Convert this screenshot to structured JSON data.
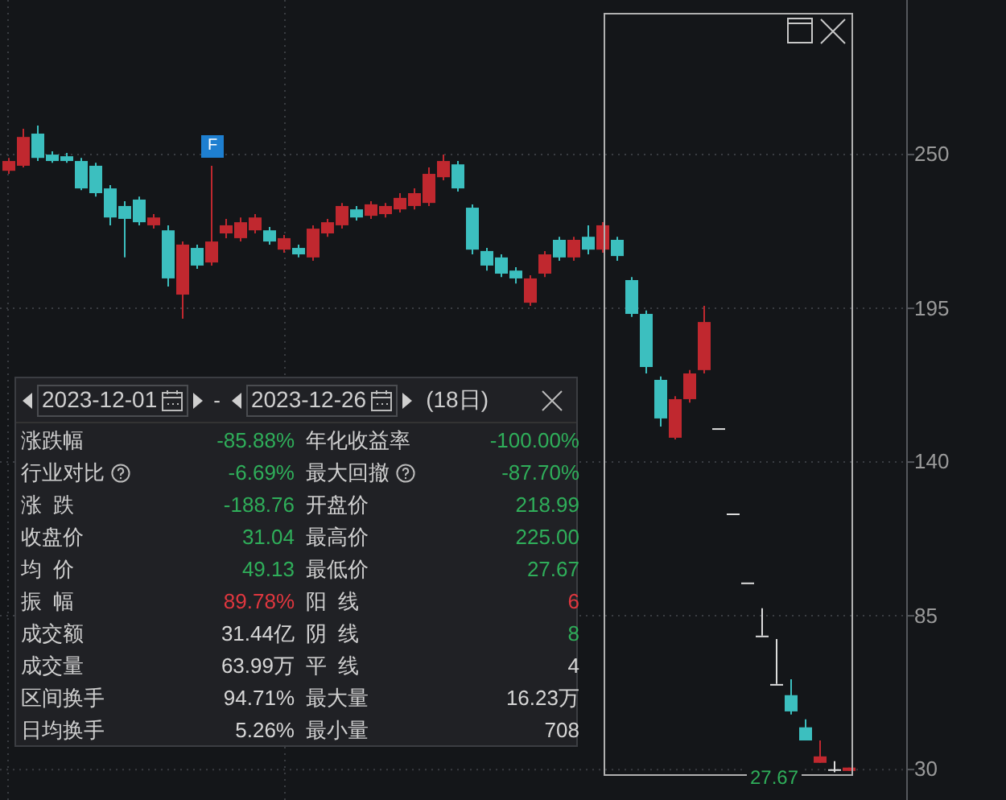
{
  "chart_data": {
    "type": "candlestick",
    "grid": true,
    "ylim": [
      19.1,
      305.3
    ],
    "yticks": [
      250,
      195,
      140,
      85,
      30
    ],
    "categories": [
      null,
      null,
      null,
      null,
      null,
      null,
      null,
      null,
      null,
      null,
      null,
      null,
      null,
      null,
      null,
      null,
      null,
      null,
      null,
      null,
      null,
      null,
      null,
      null,
      null,
      null,
      null,
      null,
      null,
      null,
      null,
      null,
      null,
      null,
      null,
      null,
      null,
      null,
      null,
      null,
      null,
      null,
      null,
      null,
      null,
      null,
      null,
      null,
      null,
      null,
      null,
      null,
      null,
      null,
      null,
      null,
      null,
      null,
      null
    ],
    "ohlc": [
      [
        244.2,
        248.8,
        243.1,
        247.7
      ],
      [
        246,
        259.2,
        245.4,
        256.3
      ],
      [
        257.5,
        260.4,
        247.7,
        248.8
      ],
      [
        250,
        251.2,
        247.1,
        247.7
      ],
      [
        249.4,
        250.6,
        247.1,
        247.7
      ],
      [
        247.7,
        248.8,
        237.3,
        237.9
      ],
      [
        246,
        247.1,
        235,
        236.2
      ],
      [
        237.9,
        239.1,
        224.7,
        227.5
      ],
      [
        231.6,
        233.3,
        213.2,
        227
      ],
      [
        233.9,
        235,
        224.7,
        225.8
      ],
      [
        224.7,
        228.7,
        223.5,
        227.5
      ],
      [
        222.9,
        224.7,
        202.8,
        205.7
      ],
      [
        199.9,
        218.9,
        191.3,
        217.8
      ],
      [
        216.6,
        217.8,
        209.1,
        210.3
      ],
      [
        211.4,
        246,
        210.3,
        218.9
      ],
      [
        221.8,
        227,
        220.1,
        224.7
      ],
      [
        220.1,
        227.5,
        218.9,
        225.8
      ],
      [
        222.9,
        228.7,
        221.8,
        227.5
      ],
      [
        222.9,
        224.1,
        217.8,
        218.9
      ],
      [
        216,
        221.2,
        214.9,
        220.1
      ],
      [
        216.6,
        217.8,
        213.2,
        214.3
      ],
      [
        213.2,
        224.7,
        212,
        223.5
      ],
      [
        221.8,
        227,
        220.6,
        225.8
      ],
      [
        224.7,
        232.7,
        223.5,
        231.6
      ],
      [
        230.4,
        231.6,
        226.4,
        227.5
      ],
      [
        228.1,
        233.3,
        227,
        232.2
      ],
      [
        228.7,
        232.7,
        227.5,
        231.6
      ],
      [
        230.4,
        236.2,
        229.3,
        234.5
      ],
      [
        231.6,
        237.9,
        230.4,
        236.2
      ],
      [
        232.7,
        245.4,
        231.6,
        243.1
      ],
      [
        241.9,
        250,
        240.8,
        247.7
      ],
      [
        246.5,
        247.7,
        236.8,
        237.9
      ],
      [
        231,
        232.2,
        214.3,
        216
      ],
      [
        215.5,
        216.6,
        208.5,
        210.3
      ],
      [
        213.2,
        214.3,
        206.2,
        207.4
      ],
      [
        208.5,
        209.7,
        203.9,
        205.7
      ],
      [
        197,
        206.8,
        195.9,
        205.7
      ],
      [
        207.4,
        215.5,
        206.2,
        214.3
      ],
      [
        219.5,
        220.6,
        212,
        213.2
      ],
      [
        213.2,
        220.6,
        212,
        219.5
      ],
      [
        220.6,
        224.7,
        214.3,
        216
      ],
      [
        216,
        225.8,
        214.9,
        224.7
      ],
      [
        219.5,
        220.6,
        212,
        213.7
      ],
      [
        205.1,
        206.2,
        191.9,
        193
      ],
      [
        193,
        194.2,
        171.7,
        174
      ],
      [
        169.4,
        170.6,
        152.7,
        155.6
      ],
      [
        148.7,
        163.6,
        148.1,
        162.5
      ],
      [
        162.5,
        172.9,
        161.3,
        171.7
      ],
      [
        172.9,
        195.9,
        171.7,
        190.1
      ],
      [
        152.1,
        152.1,
        152.1,
        152.1
      ],
      [
        121.6,
        121.6,
        121.6,
        121.6
      ],
      [
        96.9,
        96.9,
        96.9,
        96.9
      ],
      [
        77.9,
        87.7,
        77.9,
        77.9
      ],
      [
        60.6,
        76.7,
        60.6,
        60.6
      ],
      [
        56.6,
        62.3,
        49.7,
        50.8
      ],
      [
        45.1,
        48,
        40.4,
        40.4
      ],
      [
        32.4,
        40.4,
        32.4,
        34.7
      ],
      [
        30.1,
        33,
        29,
        30.1
      ],
      [
        29.5,
        30.7,
        29.5,
        30.7
      ]
    ]
  },
  "marker": {
    "label": "F"
  },
  "selection": {
    "low_label": "27.67"
  },
  "panel": {
    "start_date": "2023-12-01",
    "separator": "-",
    "end_date": "2023-12-26",
    "days": "(18日)",
    "left": [
      {
        "label": "涨跌幅",
        "value": "-85.88%",
        "color": "#2fae5a",
        "help": false
      },
      {
        "label": "行业对比",
        "value": "-6.69%",
        "color": "#2fae5a",
        "help": true
      },
      {
        "label": "涨  跌",
        "value": "-188.76",
        "color": "#2fae5a",
        "help": false
      },
      {
        "label": "收盘价",
        "value": "31.04",
        "color": "#2fae5a",
        "help": false
      },
      {
        "label": "均  价",
        "value": "49.13",
        "color": "#2fae5a",
        "help": false
      },
      {
        "label": "振  幅",
        "value": "89.78%",
        "color": "#e0373f",
        "help": false
      },
      {
        "label": "成交额",
        "value": "31.44亿",
        "color": "#d6d6d6",
        "help": false
      },
      {
        "label": "成交量",
        "value": "63.99万",
        "color": "#d6d6d6",
        "help": false
      },
      {
        "label": "区间换手",
        "value": "94.71%",
        "color": "#d6d6d6",
        "help": false
      },
      {
        "label": "日均换手",
        "value": "5.26%",
        "color": "#d6d6d6",
        "help": false
      }
    ],
    "right": [
      {
        "label": "年化收益率",
        "value": "-100.00%",
        "color": "#2fae5a",
        "help": false
      },
      {
        "label": "最大回撤",
        "value": "-87.70%",
        "color": "#2fae5a",
        "help": true
      },
      {
        "label": "开盘价",
        "value": "218.99",
        "color": "#2fae5a",
        "help": false
      },
      {
        "label": "最高价",
        "value": "225.00",
        "color": "#2fae5a",
        "help": false
      },
      {
        "label": "最低价",
        "value": "27.67",
        "color": "#2fae5a",
        "help": false
      },
      {
        "label": "阳  线",
        "value": "6",
        "color": "#e0373f",
        "help": false
      },
      {
        "label": "阴  线",
        "value": "8",
        "color": "#2fae5a",
        "help": false
      },
      {
        "label": "平  线",
        "value": "4",
        "color": "#d6d6d6",
        "help": false
      },
      {
        "label": "最大量",
        "value": "16.23万",
        "color": "#d6d6d6",
        "help": false
      },
      {
        "label": "最小量",
        "value": "708",
        "color": "#d6d6d6",
        "help": false
      }
    ]
  }
}
